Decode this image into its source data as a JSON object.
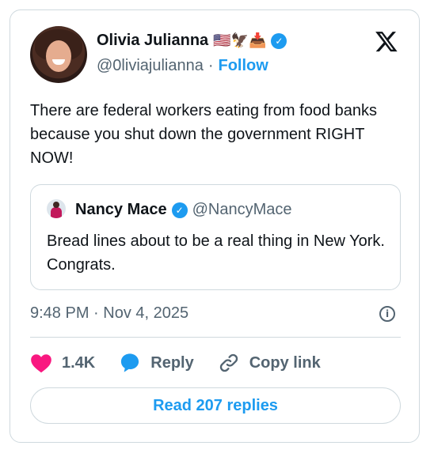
{
  "author": {
    "name": "Olivia Julianna",
    "name_emojis": "🇺🇸🦅📥",
    "handle": "@0liviajulianna",
    "separator": "·",
    "follow_label": "Follow"
  },
  "tweet": {
    "text": "There are federal workers eating from food banks because you shut down the government RIGHT NOW!",
    "timestamp": "9:48 PM · Nov 4, 2025"
  },
  "quote": {
    "name": "Nancy Mace",
    "handle": "@NancyMace",
    "text": "Bread lines about to be a real thing in New York. Congrats."
  },
  "actions": {
    "likes": "1.4K",
    "reply_label": "Reply",
    "copy_label": "Copy link"
  },
  "read_replies_label": "Read 207 replies",
  "icons": {
    "verified": "verified-badge-icon",
    "x_logo": "x-logo-icon",
    "info": "info-icon",
    "heart": "heart-icon",
    "reply": "reply-bubble-icon",
    "link": "link-icon"
  },
  "colors": {
    "accent": "#1d9bf0",
    "like": "#f91880",
    "secondary_text": "#536471",
    "border": "#cfd9de"
  }
}
